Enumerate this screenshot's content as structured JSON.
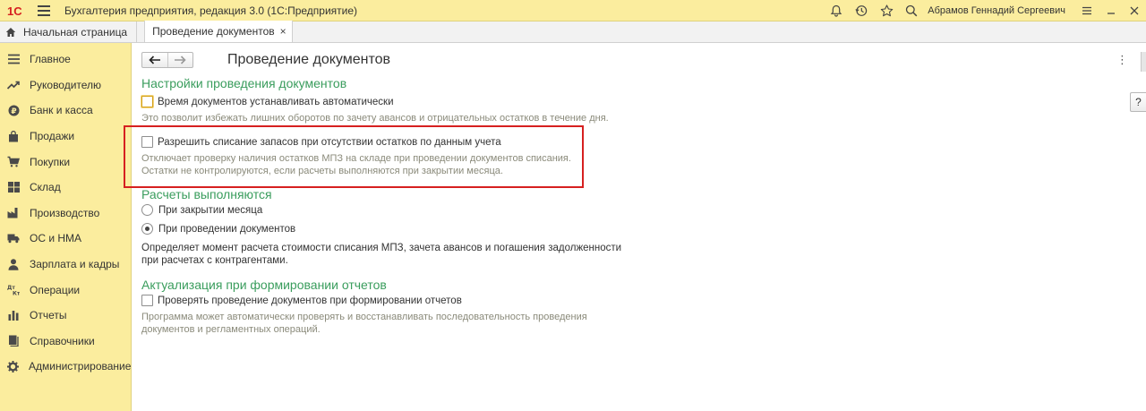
{
  "titlebar": {
    "logo": "1С",
    "app_title": "Бухгалтерия предприятия, редакция 3.0  (1С:Предприятие)",
    "user_name": "Абрамов Геннадий Сергеевич",
    "icons": [
      "menu-icon",
      "bell-icon",
      "history-icon",
      "star-icon",
      "search-icon",
      "settings-icon",
      "minimize-icon",
      "close-icon"
    ]
  },
  "tabs": {
    "home_label": "Начальная страница",
    "active_label": "Проведение документов",
    "close_glyph": "×"
  },
  "sidebar": {
    "items": [
      {
        "label": "Главное",
        "icon": "menu-icon"
      },
      {
        "label": "Руководителю",
        "icon": "trend-icon"
      },
      {
        "label": "Банк и касса",
        "icon": "ruble-icon"
      },
      {
        "label": "Продажи",
        "icon": "bag-icon"
      },
      {
        "label": "Покупки",
        "icon": "cart-icon"
      },
      {
        "label": "Склад",
        "icon": "grid-icon"
      },
      {
        "label": "Производство",
        "icon": "factory-icon"
      },
      {
        "label": "ОС и НМА",
        "icon": "truck-icon"
      },
      {
        "label": "Зарплата и кадры",
        "icon": "person-icon"
      },
      {
        "label": "Операции",
        "icon": "dt-kt-icon"
      },
      {
        "label": "Отчеты",
        "icon": "bar-chart-icon"
      },
      {
        "label": "Справочники",
        "icon": "books-icon"
      },
      {
        "label": "Администрирование",
        "icon": "gear-icon"
      }
    ]
  },
  "page": {
    "title": "Проведение документов",
    "more_glyph": "⋮",
    "help_glyph": "?"
  },
  "settings": {
    "section1_title": "Настройки проведения документов",
    "auto_time_label": "Время документов устанавливать автоматически",
    "auto_time_checked": false,
    "auto_time_note": "Это позволит избежать лишних оборотов по зачету авансов и отрицательных остатков в течение дня.",
    "allow_writeoff_label": "Разрешить списание запасов при отсутствии остатков по данным учета",
    "allow_writeoff_checked": false,
    "allow_writeoff_note_1": "Отключает проверку наличия остатков МПЗ на складе при проведении документов списания.",
    "allow_writeoff_note_2": "Остатки не контролируются, если расчеты выполняются при закрытии месяца.",
    "section2_title": "Расчеты выполняются",
    "radio_month_close": "При закрытии месяца",
    "radio_doc_posting": "При проведении документов",
    "radio_selected": "При проведении документов",
    "calc_desc_1": "Определяет момент расчета стоимости списания МПЗ, зачета авансов и погашения задолженности",
    "calc_desc_2": "при расчетах с контрагентами.",
    "section3_title": "Актуализация при формировании отчетов",
    "check_posting_label": "Проверять проведение документов при формировании отчетов",
    "check_posting_checked": false,
    "check_posting_note_1": "Программа может автоматически проверять и восстанавливать последовательность проведения",
    "check_posting_note_2": "документов и регламентных операций."
  },
  "colors": {
    "panel_yellow": "#fbed9e",
    "section_green": "#3a9d5d",
    "highlight_red": "#d62020"
  }
}
